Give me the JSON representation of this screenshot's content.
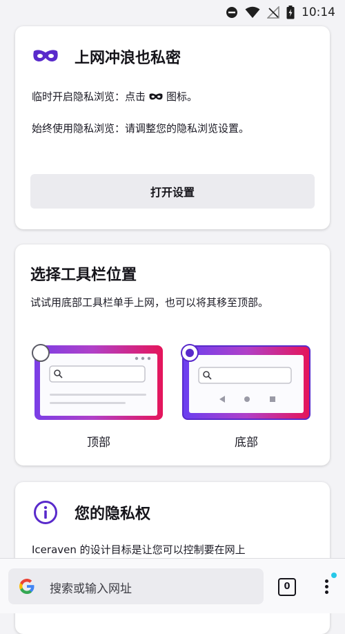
{
  "status_bar": {
    "time": "10:14",
    "icons": [
      "do-not-disturb-icon",
      "wifi-icon",
      "no-signal-icon",
      "battery-icon"
    ]
  },
  "private_card": {
    "title": "上网冲浪也私密",
    "line1_before": "临时开启隐私浏览：点击",
    "line1_after": "图标。",
    "line2": "始终使用隐私浏览：请调整您的隐私浏览设置。",
    "button_label": "打开设置",
    "accent_color": "#592acb"
  },
  "toolbar_card": {
    "title": "选择工具栏位置",
    "description": "试试用底部工具栏单手上网，也可以将其移至顶部。",
    "option_top_label": "顶部",
    "option_bottom_label": "底部",
    "selected": "bottom"
  },
  "privacy_card": {
    "title": "您的隐私权",
    "text": "Iceraven 的设计目标是让您可以控制要在网上"
  },
  "bottom_bar": {
    "search_placeholder": "搜索或输入网址",
    "tab_count": "0"
  }
}
